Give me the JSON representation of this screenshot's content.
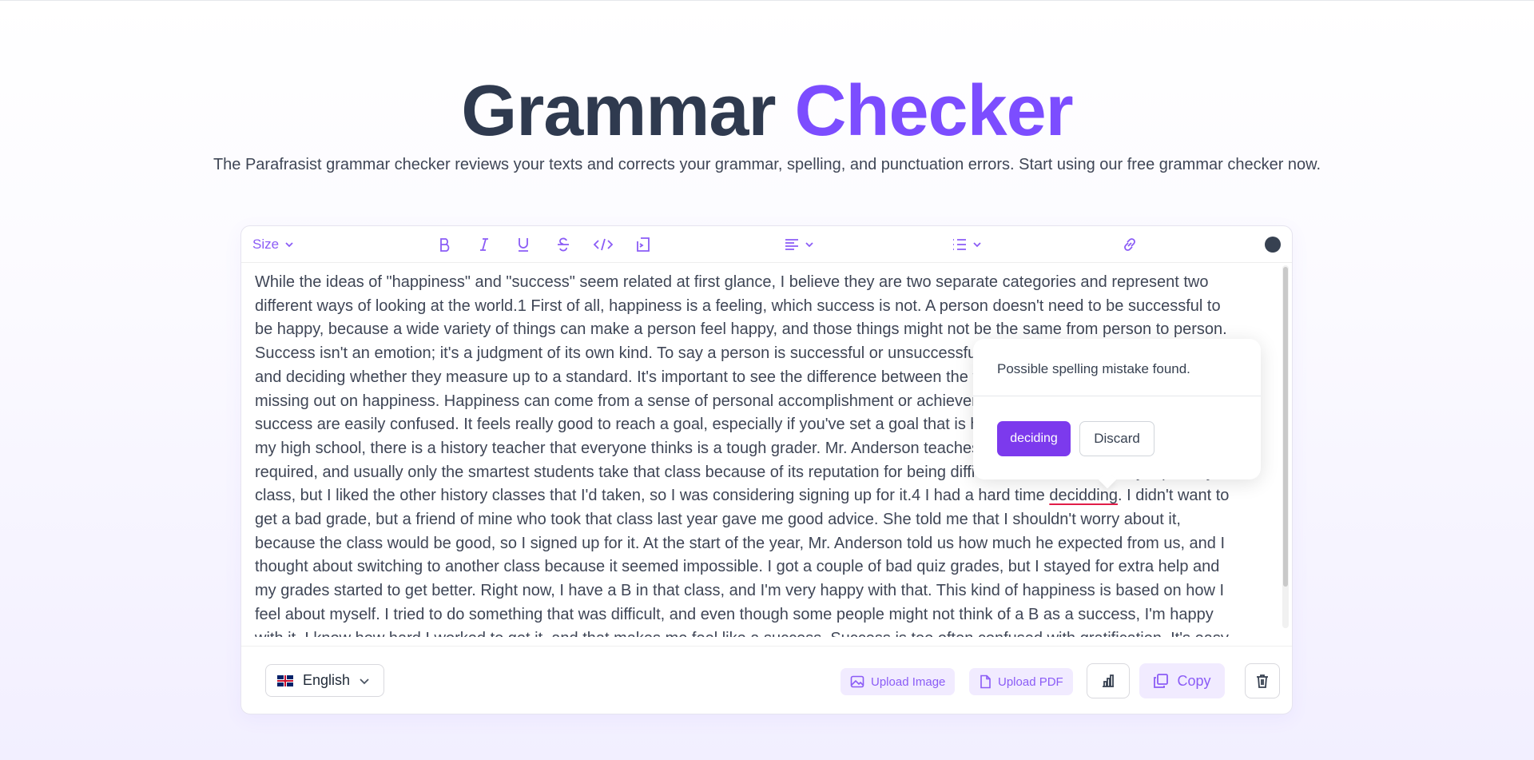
{
  "hero": {
    "title_part1": "Grammar",
    "title_part2": "Checker",
    "subtitle": "The Parafrasist grammar checker reviews your texts and corrects your grammar, spelling, and punctuation errors. Start using our free grammar checker now."
  },
  "toolbar": {
    "size_label": "Size",
    "icons": [
      "bold-icon",
      "italic-icon",
      "underline-icon",
      "strikethrough-icon",
      "code-icon",
      "code-block-icon",
      "align-left-icon",
      "list-icon",
      "link-icon"
    ]
  },
  "editor": {
    "text_before": "While the ideas of \"happiness\" and \"success\" seem related at first glance, I believe they are two separate categories and represent two\ndifferent ways of looking at the world.1 First of all, happiness is a feeling, which success is not. A person doesn't need to be successful to\nbe happy, because a wide variety of things can make a person feel happy, and those things might not be the same from person to person.\nSuccess isn't an emotion; it's a judgment of its own kind. To say a person is successful or unsuccessful means looking at their actions\nand deciding whether they measure up to a standard. It's important to see the difference between the two so that people won't end up\nmissing out on happiness. Happiness can come from a sense of personal accomplishment or achievement, which is why happiness and\nsuccess are easily confused. It feels really good to reach a goal, especially if you've set a goal that is hard to reach. For example, at\nmy high school, there is a history teacher that everyone thinks is a tough grader. Mr. Anderson teaches an advanced history class that isn't\nrequired, and usually only the smartest students take that class because of its reputation for being difficult.3 I'm not at the very top of my\nclass, but I liked the other history classes that I'd taken, so I was considering signing up for it.4 I had a hard time ",
    "error_word": "decidding",
    "text_after": ". I didn't want to\nget a bad grade, but a friend of mine who took that class last year gave me good advice. She told me that I shouldn't worry about it,\nbecause the class would be good, so I signed up for it. At the start of the year, Mr. Anderson told us how much he expected from us, and I\nthought about switching to another class because it seemed impossible. I got a couple of bad quiz grades, but I stayed for extra help and\nmy grades started to get better. Right now, I have a B in that class, and I'm very happy with that. This kind of happiness is based on how I\nfeel about myself. I tried to do something that was difficult, and even though some people might not think of a B as a success, I'm happy\nwith it. I know how hard I worked to get it, and that makes me feel like a success. Success is too often confused with gratification. It's easy"
  },
  "popup": {
    "message": "Possible spelling mistake found.",
    "suggestion": "deciding",
    "discard_label": "Discard"
  },
  "footer": {
    "language": "English",
    "upload_image_label": "Upload Image",
    "upload_pdf_label": "Upload PDF",
    "copy_label": "Copy"
  },
  "colors": {
    "accent": "#7c4dff",
    "title_dark": "#2f3a4f",
    "error_underline": "#e11d48"
  }
}
